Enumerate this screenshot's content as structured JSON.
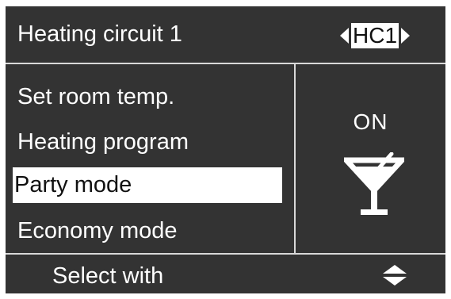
{
  "header": {
    "title": "Heating circuit 1",
    "circuit_selector": {
      "value": "HC1",
      "left_icon": "arrow-left-icon",
      "right_icon": "arrow-right-icon"
    }
  },
  "menu": {
    "items": [
      {
        "label": "Set room temp.",
        "selected": false
      },
      {
        "label": "Heating program",
        "selected": false
      },
      {
        "label": "Party mode",
        "selected": true
      },
      {
        "label": "Economy mode",
        "selected": false
      }
    ]
  },
  "status": {
    "text": "ON",
    "icon": "cocktail-glass-icon"
  },
  "footer": {
    "label": "Select with",
    "icon": "up-down-arrows-icon"
  },
  "colors": {
    "background": "#333333",
    "foreground": "#ffffff",
    "selected_background": "#ffffff",
    "selected_text": "#111111",
    "divider": "#d9d9d9"
  }
}
